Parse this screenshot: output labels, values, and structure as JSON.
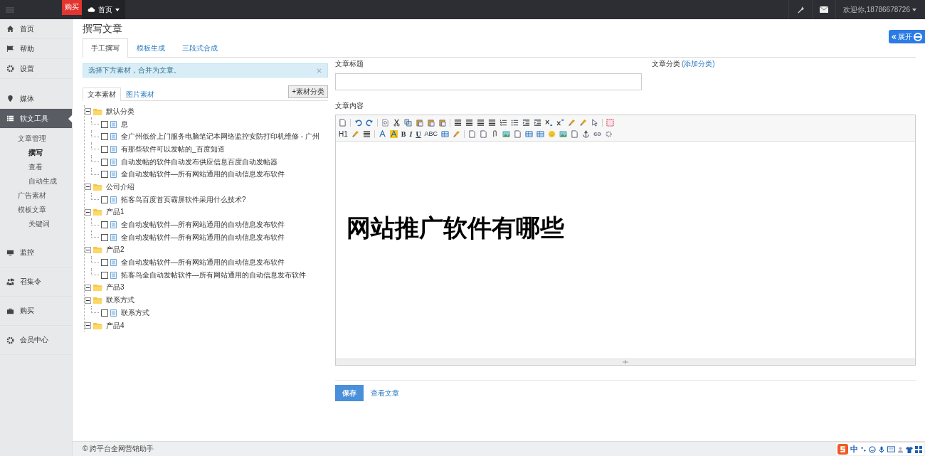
{
  "topbar": {
    "buy_badge": "购买",
    "home_menu": "首页",
    "user_menu": "欢迎你,18786678726"
  },
  "sidebar": {
    "items": [
      {
        "label": "首页",
        "selected": false
      },
      {
        "label": "帮助",
        "selected": false
      },
      {
        "label": "设置",
        "selected": false
      },
      {
        "label": "媒体",
        "selected": false
      },
      {
        "label": "软文工具",
        "selected": true,
        "children": [
          {
            "label": "文章管理",
            "selected": false,
            "children": [
              {
                "label": "撰写",
                "selected": true
              },
              {
                "label": "查看",
                "selected": false
              },
              {
                "label": "自动生成",
                "selected": false
              }
            ]
          },
          {
            "label": "广告素材",
            "selected": false
          },
          {
            "label": "模板文章",
            "selected": false,
            "children": [
              {
                "label": "关键词",
                "selected": false
              }
            ]
          }
        ]
      },
      {
        "label": "监控",
        "selected": false
      },
      {
        "label": "召集令",
        "selected": false
      },
      {
        "label": "购买",
        "selected": false
      },
      {
        "label": "会员中心",
        "selected": false
      }
    ]
  },
  "page": {
    "title": "撰写文章",
    "tabs": [
      {
        "label": "手工撰写",
        "selected": true
      },
      {
        "label": "模板生成",
        "selected": false
      },
      {
        "label": "三段式合成",
        "selected": false
      }
    ],
    "alert": "选择下方素材，合并为文章。",
    "material_tabs": [
      {
        "label": "文本素材",
        "selected": true
      },
      {
        "label": "图片素材",
        "selected": false
      }
    ],
    "add_category_button": "+素材分类",
    "tree": [
      {
        "label": "默认分类",
        "expanded": true,
        "children": [
          {
            "label": "息",
            "checked": false
          },
          {
            "label": "全广州低价上门服务电脑笔记本网络监控安防打印机维修 - 广州",
            "checked": false
          },
          {
            "label": "有那些软件可以发帖的_百度知道",
            "checked": false
          },
          {
            "label": "自动发帖的软件自动发布供应信息百度自动发帖器",
            "checked": false
          },
          {
            "label": "全自动发帖软件—所有网站通用的自动信息发布软件",
            "checked": false
          }
        ]
      },
      {
        "label": "公司介绍",
        "expanded": true,
        "children": [
          {
            "label": "拓客鸟百度首页霸屏软件采用什么技术?",
            "checked": false
          }
        ]
      },
      {
        "label": "产品1",
        "expanded": true,
        "children": [
          {
            "label": "全自动发帖软件—所有网站通用的自动信息发布软件",
            "checked": false
          },
          {
            "label": "全自动发帖软件—所有网站通用的自动信息发布软件",
            "checked": false
          }
        ]
      },
      {
        "label": "产品2",
        "expanded": true,
        "children": [
          {
            "label": "全自动发帖软件—所有网站通用的自动信息发布软件",
            "checked": false
          },
          {
            "label": "拓客鸟全自动发帖软件—所有网站通用的自动信息发布软件",
            "checked": false
          }
        ]
      },
      {
        "label": "产品3",
        "expanded": true
      },
      {
        "label": "联系方式",
        "expanded": true,
        "children": [
          {
            "label": "联系方式",
            "checked": false
          }
        ]
      },
      {
        "label": "产品4",
        "expanded": true
      }
    ],
    "title_label": "文章标题",
    "category_label": "文章分类",
    "add_category_link": "(添加分类)",
    "content_label": "文章内容",
    "toolbar_text_buttons": [
      "H1",
      "B",
      "I",
      "U",
      "ABC"
    ],
    "save_button": "保存",
    "view_link": "查看文章",
    "expand_button": "展开",
    "overlay_title": "网站推广软件有哪些"
  },
  "footer": "© 跨平台全网营销助手",
  "ime": {
    "label": "中"
  }
}
